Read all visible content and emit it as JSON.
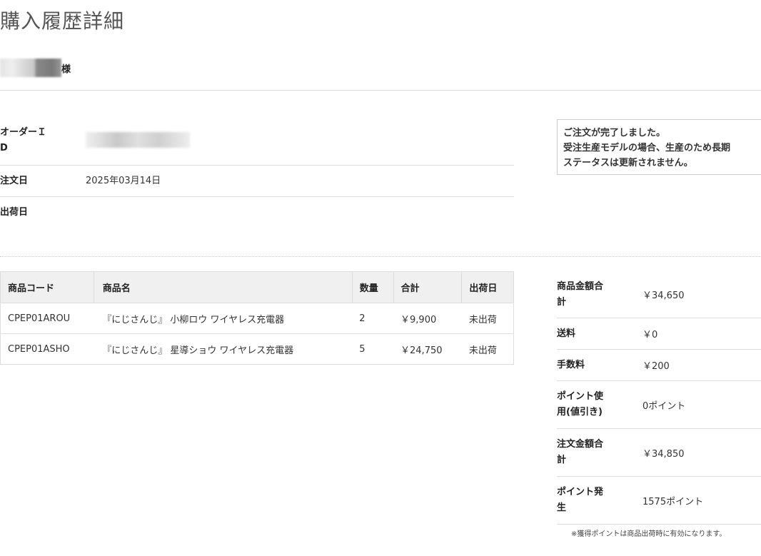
{
  "page": {
    "title": "購入履歴詳細"
  },
  "customer": {
    "suffix": "様"
  },
  "order": {
    "id_label_1": "オーダーＩ",
    "id_label_2": "D",
    "order_date_label": "注文日",
    "order_date_value": "2025年03月14日",
    "ship_date_label": "出荷日",
    "ship_date_value": ""
  },
  "notice": {
    "line1": "ご注文が完了しました。",
    "line2": "受注生産モデルの場合、生産のため長期",
    "line3": "ステータスは更新されません。"
  },
  "items_table": {
    "headers": [
      "商品コード",
      "商品名",
      "数量",
      "合計",
      "出荷日"
    ],
    "rows": [
      {
        "code": "CPEP01AROU",
        "name": "『にじさんじ』 小柳ロウ ワイヤレス充電器",
        "qty": "2",
        "total": "￥9,900",
        "ship": "未出荷"
      },
      {
        "code": "CPEP01ASHO",
        "name": "『にじさんじ』 星導ショウ ワイヤレス充電器",
        "qty": "5",
        "total": "￥24,750",
        "ship": "未出荷"
      }
    ]
  },
  "summary": {
    "rows": [
      {
        "label_1": "商品金額合",
        "label_2": "計",
        "value": "￥34,650"
      },
      {
        "label_1": "送料",
        "label_2": "",
        "value": "￥0"
      },
      {
        "label_1": "手数料",
        "label_2": "",
        "value": "￥200"
      },
      {
        "label_1": "ポイント使",
        "label_2": "用(値引き)",
        "value": "0ポイント"
      },
      {
        "label_1": "注文金額合",
        "label_2": "計",
        "value": "￥34,850"
      },
      {
        "label_1": "ポイント発",
        "label_2": "生",
        "value": "1575ポイント"
      }
    ]
  },
  "footnote": "※獲得ポイントは商品出荷時に有効になります。"
}
